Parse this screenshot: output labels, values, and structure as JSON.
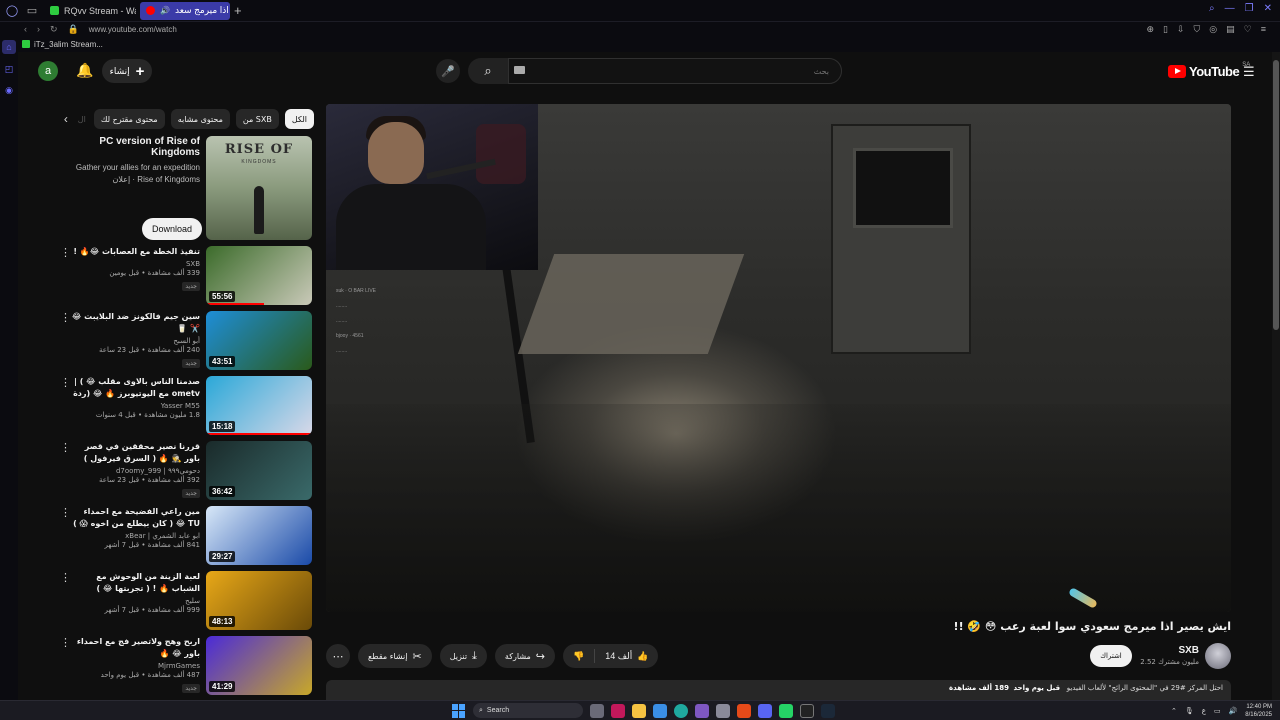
{
  "browser": {
    "tabs": [
      {
        "label": "RQvv Stream - Watch Liv",
        "active": false
      },
      {
        "label": "ايش يصير اذا ميرمج سعد",
        "active": true
      }
    ],
    "url": "www.youtube.com/watch",
    "bookmark": "iTz_3alim Stream...",
    "accent_color": "#3b3ba8"
  },
  "header": {
    "avatar_letter": "a",
    "create_label": "إنشاء",
    "search_placeholder": "بحث",
    "logo_text": "YouTube",
    "logo_region": "SA"
  },
  "chips": [
    "الكل",
    "من SXB",
    "محتوى مشابه",
    "محتوى مقترح لك",
    "ال"
  ],
  "ad": {
    "title": "PC version of Rise of Kingdoms",
    "description": "Gather your allies for an expedition",
    "sponsor": "إعلان · Rise of Kingdoms",
    "thumb_logo": "RISE OF",
    "thumb_sub": "KINGDOMS",
    "button_label": "Download"
  },
  "related": [
    {
      "title": "تنفيذ الخطة مع العصابات 😂🔥 !",
      "channel": "SXB",
      "stats": "339 ألف مشاهدة • قبل يومين",
      "badge": "جديد",
      "duration": "55:56",
      "colors": [
        "#3b6b2a",
        "#c9c9b8"
      ],
      "progress": 0.55
    },
    {
      "title": "سين جيم فالكونز ضد البلايبت 😂 ✂️ 🥛",
      "channel": "أبو السبح",
      "stats": "240 ألف مشاهدة • قبل 23 ساعة",
      "badge": "جديد",
      "duration": "43:51",
      "colors": [
        "#1e8ed8",
        "#2a5a1a"
      ],
      "progress": 0
    },
    {
      "title": "صدمنا الناس بالاوى مقلب 😂 ) | ometv مع اليوتيوبرز 🔥 😂 (ردة فعلهم سجبونه",
      "channel": "Yasser M55",
      "stats": "1.8 مليون مشاهدة • قبل 4 سنوات",
      "badge": "",
      "duration": "15:18",
      "colors": [
        "#2aa8d8",
        "#d8d8e8"
      ],
      "progress": 1
    },
    {
      "title": "قررنا نصير محققين في قصر باور 🕵️ 🔥 ( السرق فيرفول )",
      "channel": "d7oomy_999 | دحومي٩٩٩",
      "stats": "392 ألف مشاهدة • قبل 23 ساعة",
      "badge": "جديد",
      "duration": "36:42",
      "colors": [
        "#1a2a2a",
        "#3a6a6a"
      ],
      "progress": 0
    },
    {
      "title": "مين راعي الفضيحة مع احمداء TU 😂 ( كان بيطلع من اخوه 😱 )",
      "channel": "xBear | ابو عابد الشمري",
      "stats": "841 ألف مشاهدة • قبل 7 أشهر",
      "badge": "",
      "duration": "29:27",
      "colors": [
        "#d8e8f8",
        "#1a4aa8"
      ],
      "progress": 0
    },
    {
      "title": "لعبة الزينة من الوحوش مع الشباب 🔥 ! ( تجربتها 😂 )",
      "channel": "سليح",
      "stats": "999 ألف مشاهدة • قبل 7 أشهر",
      "badge": "",
      "duration": "48:13",
      "colors": [
        "#e8a818",
        "#6a4a08"
      ],
      "progress": 0
    },
    {
      "title": "اربح وهج ولاتصير فج مع احمداء باور 😂 🔥",
      "channel": "MjrmGames",
      "stats": "487 ألف مشاهدة • قبل يوم واحد",
      "badge": "جديد",
      "duration": "41:29",
      "colors": [
        "#4a2ad8",
        "#c8a828"
      ],
      "progress": 0
    }
  ],
  "player": {
    "chat_lines": [
      "suk · O BAR  LIVE",
      "........",
      "........",
      "bjooy · 4561",
      "........"
    ]
  },
  "video": {
    "title": "ايش يصير اذا ميرمج سعودي سوا لعبة رعب 😳 🤣 !!",
    "likes": "14 ألف",
    "share_label": "مشاركة",
    "download_label": "تنزيل",
    "clip_label": "إنشاء مقطع",
    "channel_name": "SXB",
    "subscribers": "2.52 مليون مشترك",
    "subscribe_label": "اشتراك",
    "views": "189 ألف مشاهدة",
    "age": "قبل يوم واحد",
    "trend": "احتل المركز #29 في \"المحتوى الرائج\" لألعاب الفيديو"
  },
  "taskbar": {
    "search_label": "Search",
    "time": "12:40 PM",
    "date": "8/16/2025",
    "lang": "ع"
  }
}
